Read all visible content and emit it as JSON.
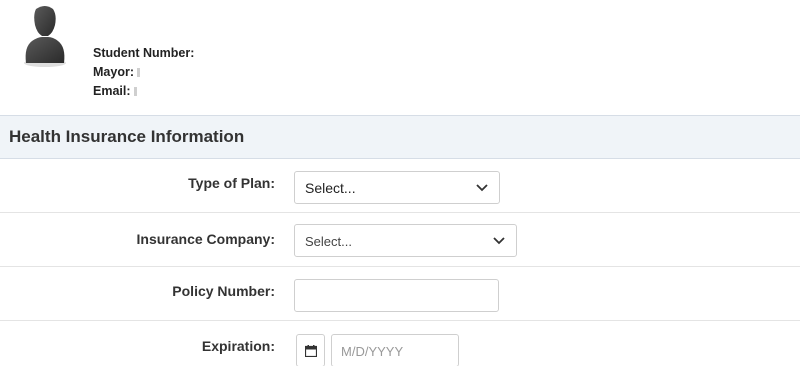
{
  "profile": {
    "student_number_label": "Student Number:",
    "mayor_label": "Mayor:",
    "email_label": "Email:"
  },
  "section": {
    "title": "Health Insurance Information"
  },
  "form": {
    "type_of_plan": {
      "label": "Type of Plan:",
      "value": "Select..."
    },
    "insurance_company": {
      "label": "Insurance Company:",
      "value": "Select..."
    },
    "policy_number": {
      "label": "Policy Number:",
      "value": ""
    },
    "expiration": {
      "label": "Expiration:",
      "placeholder": "M/D/YYYY"
    }
  },
  "icons": {
    "avatar": "user-silhouette-icon",
    "chevron": "chevron-down-icon",
    "calendar": "calendar-icon"
  },
  "colors": {
    "header_bg": "#f0f4f8",
    "border": "#cfcfcf",
    "avatar": "#3a3a3a"
  }
}
